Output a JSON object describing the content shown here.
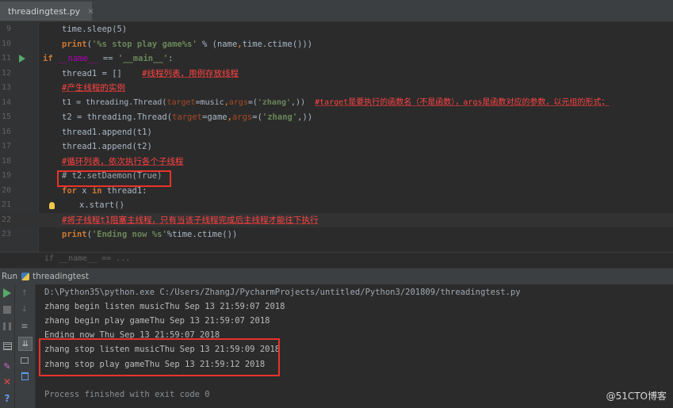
{
  "tab": {
    "filename": "threadingtest.py",
    "close": "×"
  },
  "editor": {
    "lines": [
      {
        "num": "9"
      },
      {
        "num": "10"
      },
      {
        "num": "11"
      },
      {
        "num": "12"
      },
      {
        "num": "13"
      },
      {
        "num": "14"
      },
      {
        "num": "15"
      },
      {
        "num": "16"
      },
      {
        "num": "17"
      },
      {
        "num": "18"
      },
      {
        "num": "19"
      },
      {
        "num": "20"
      },
      {
        "num": "21"
      },
      {
        "num": "22"
      },
      {
        "num": "23"
      }
    ],
    "code": {
      "l9_a": "time.sleep(5)",
      "l10_kw": "print",
      "l10_p": "(",
      "l10_s": "'%s stop play game%s'",
      "l10_b": " % (name",
      "l10_c": ",",
      "l10_d": "time.ctime()))",
      "l11_kw": "if",
      "l11_m1": " __name__ ",
      "l11_op": "== ",
      "l11_s": "'__main__'",
      "l11_e": ":",
      "l12_a": "thread1 = []    ",
      "l12_c": "#线程列表，用例存放线程",
      "l13_c": "#产生线程的实例",
      "l14_a": "t1 = threading.Thread(",
      "l14_p1": "target",
      "l14_b": "=music",
      "l14_c": ",",
      "l14_p2": "args",
      "l14_d": "=(",
      "l14_s": "'zhang'",
      "l14_e": ",))  ",
      "l14_cmt": "#target是要执行的函数名（不是函数），args是函数对应的参数，以元组的形式；",
      "l15_a": "t2 = threading.Thread(",
      "l15_p1": "target",
      "l15_b": "=game",
      "l15_c": ",",
      "l15_p2": "args",
      "l15_d": "=(",
      "l15_s": "'zhang'",
      "l15_e": ",))",
      "l16_a": "thread1.append(t1)",
      "l17_a": "thread1.append(t2)",
      "l18_c": "#循环列表，依次执行各个子线程",
      "l19_a": "# t2.setDaemon(True)",
      "l20_kw1": "for",
      "l20_a": " x ",
      "l20_kw2": "in",
      "l20_b": " thread1:",
      "l21_a": "x.start()",
      "l22_c": "#将子线程t1阻塞主线程，只有当该子线程完成后主线程才能往下执行",
      "l23_kw": "print",
      "l23_p": "(",
      "l23_s": "'Ending now %s'",
      "l23_b": "%time.ctime())"
    }
  },
  "breadcrumb": "if __name__ == ...",
  "run_panel": {
    "title": "Run",
    "file": "threadingtest",
    "console": [
      "D:\\Python35\\python.exe C:/Users/ZhangJ/PycharmProjects/untitled/Python3/201809/threadingtest.py",
      "zhang begin listen musicThu Sep 13 21:59:07 2018",
      "zhang begin play gameThu Sep 13 21:59:07 2018",
      "Ending now Thu Sep 13 21:59:07 2018",
      "zhang stop listen musicThu Sep 13 21:59:09 2018",
      "zhang stop play gameThu Sep 13 21:59:12 2018",
      "Process finished with exit code 0"
    ]
  },
  "watermark": "@51CTO博客",
  "colors": {
    "highlight_box": "#e8322b",
    "comment": "#ff4444",
    "keyword": "#cc7832",
    "string": "#6a8759"
  }
}
